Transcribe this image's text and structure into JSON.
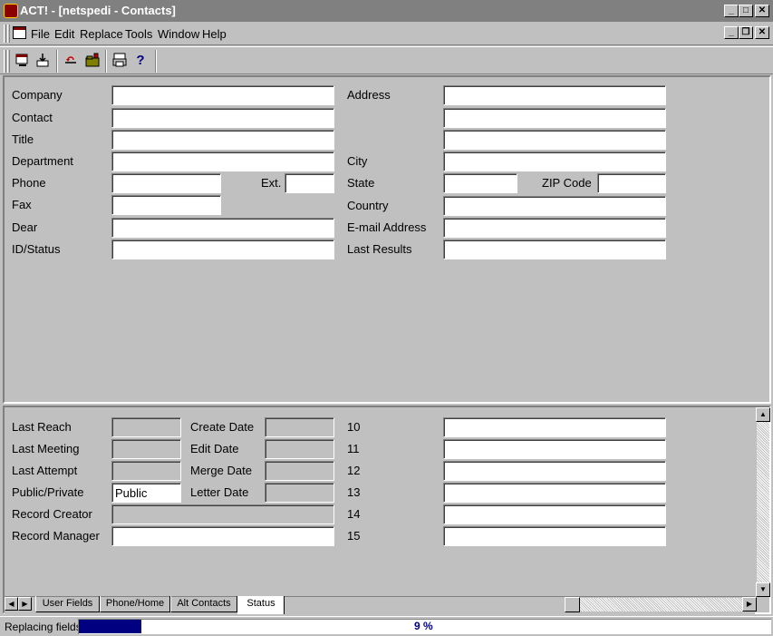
{
  "window": {
    "title": "ACT! - [netspedi - Contacts]",
    "minimize": "_",
    "maximize": "□",
    "close": "✕",
    "doc_minimize": "_",
    "doc_restore": "❐",
    "doc_close": "✕"
  },
  "menu": [
    "File",
    "Edit",
    "Replace",
    "Tools",
    "Window",
    "Help"
  ],
  "toolbar": {
    "icons": [
      "replace-icon",
      "import-icon",
      "undo-icon",
      "open-folder-icon",
      "print-icon",
      "help-icon"
    ],
    "help_glyph": "?"
  },
  "contact": {
    "left_labels": [
      "Company",
      "Contact",
      "Title",
      "Department",
      "Phone",
      "Fax",
      "Dear",
      "ID/Status"
    ],
    "ext_label": "Ext.",
    "right_labels": {
      "address": "Address",
      "city": "City",
      "state": "State",
      "zip": "ZIP Code",
      "country": "Country",
      "email": "E-mail Address",
      "last_results": "Last Results"
    }
  },
  "status": {
    "left_labels": [
      "Last Reach",
      "Last Meeting",
      "Last Attempt",
      "Public/Private",
      "Record Creator",
      "Record Manager"
    ],
    "mid_labels": [
      "Create Date",
      "Edit Date",
      "Merge Date",
      "Letter Date"
    ],
    "public_private_value": "Public",
    "user_numbers": [
      "10",
      "11",
      "12",
      "13",
      "14",
      "15"
    ]
  },
  "tabs": [
    "User Fields",
    "Phone/Home",
    "Alt Contacts",
    "Status"
  ],
  "active_tab": "Status",
  "statusbar": {
    "text": "Replacing fields",
    "progress_label": "9 %",
    "progress_fraction": 0.09
  },
  "colors": {
    "titlebar_inactive": "#808080",
    "progress": "#000080",
    "face": "#c0c0c0"
  }
}
